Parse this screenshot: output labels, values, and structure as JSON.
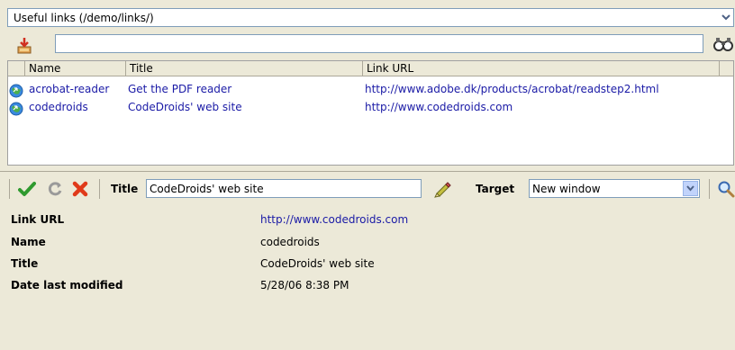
{
  "folder_select": {
    "value": "Useful links (/demo/links/)"
  },
  "search": {
    "placeholder": "",
    "value": ""
  },
  "list": {
    "headers": {
      "name": "Name",
      "title": "Title",
      "url": "Link URL"
    },
    "rows": [
      {
        "name": "acrobat-reader",
        "title": "Get the PDF reader",
        "url": "http://www.adobe.dk/products/acrobat/readstep2.html"
      },
      {
        "name": "codedroids",
        "title": "CodeDroids' web site",
        "url": "http://www.codedroids.com"
      }
    ]
  },
  "editor": {
    "title_label": "Title",
    "title_value": "CodeDroids' web site",
    "target_label": "Target",
    "target_value": "New window"
  },
  "details": {
    "link_url_label": "Link URL",
    "link_url_value": "http://www.codedroids.com",
    "name_label": "Name",
    "name_value": "codedroids",
    "title_label": "Title",
    "title_value": "CodeDroids' web site",
    "date_label": "Date last modified",
    "date_value": "5/28/06 8:38 PM"
  },
  "icons": {
    "export": "export-icon",
    "search": "binoculars-icon",
    "link_row": "web-link-icon",
    "save": "checkmark-icon",
    "refresh": "refresh-icon",
    "delete": "delete-icon",
    "edit": "pencil-icon",
    "preview": "magnifier-icon"
  },
  "colors": {
    "link": "#1a1aa6",
    "panel": "#ece9d8",
    "border": "#7f9db9"
  }
}
